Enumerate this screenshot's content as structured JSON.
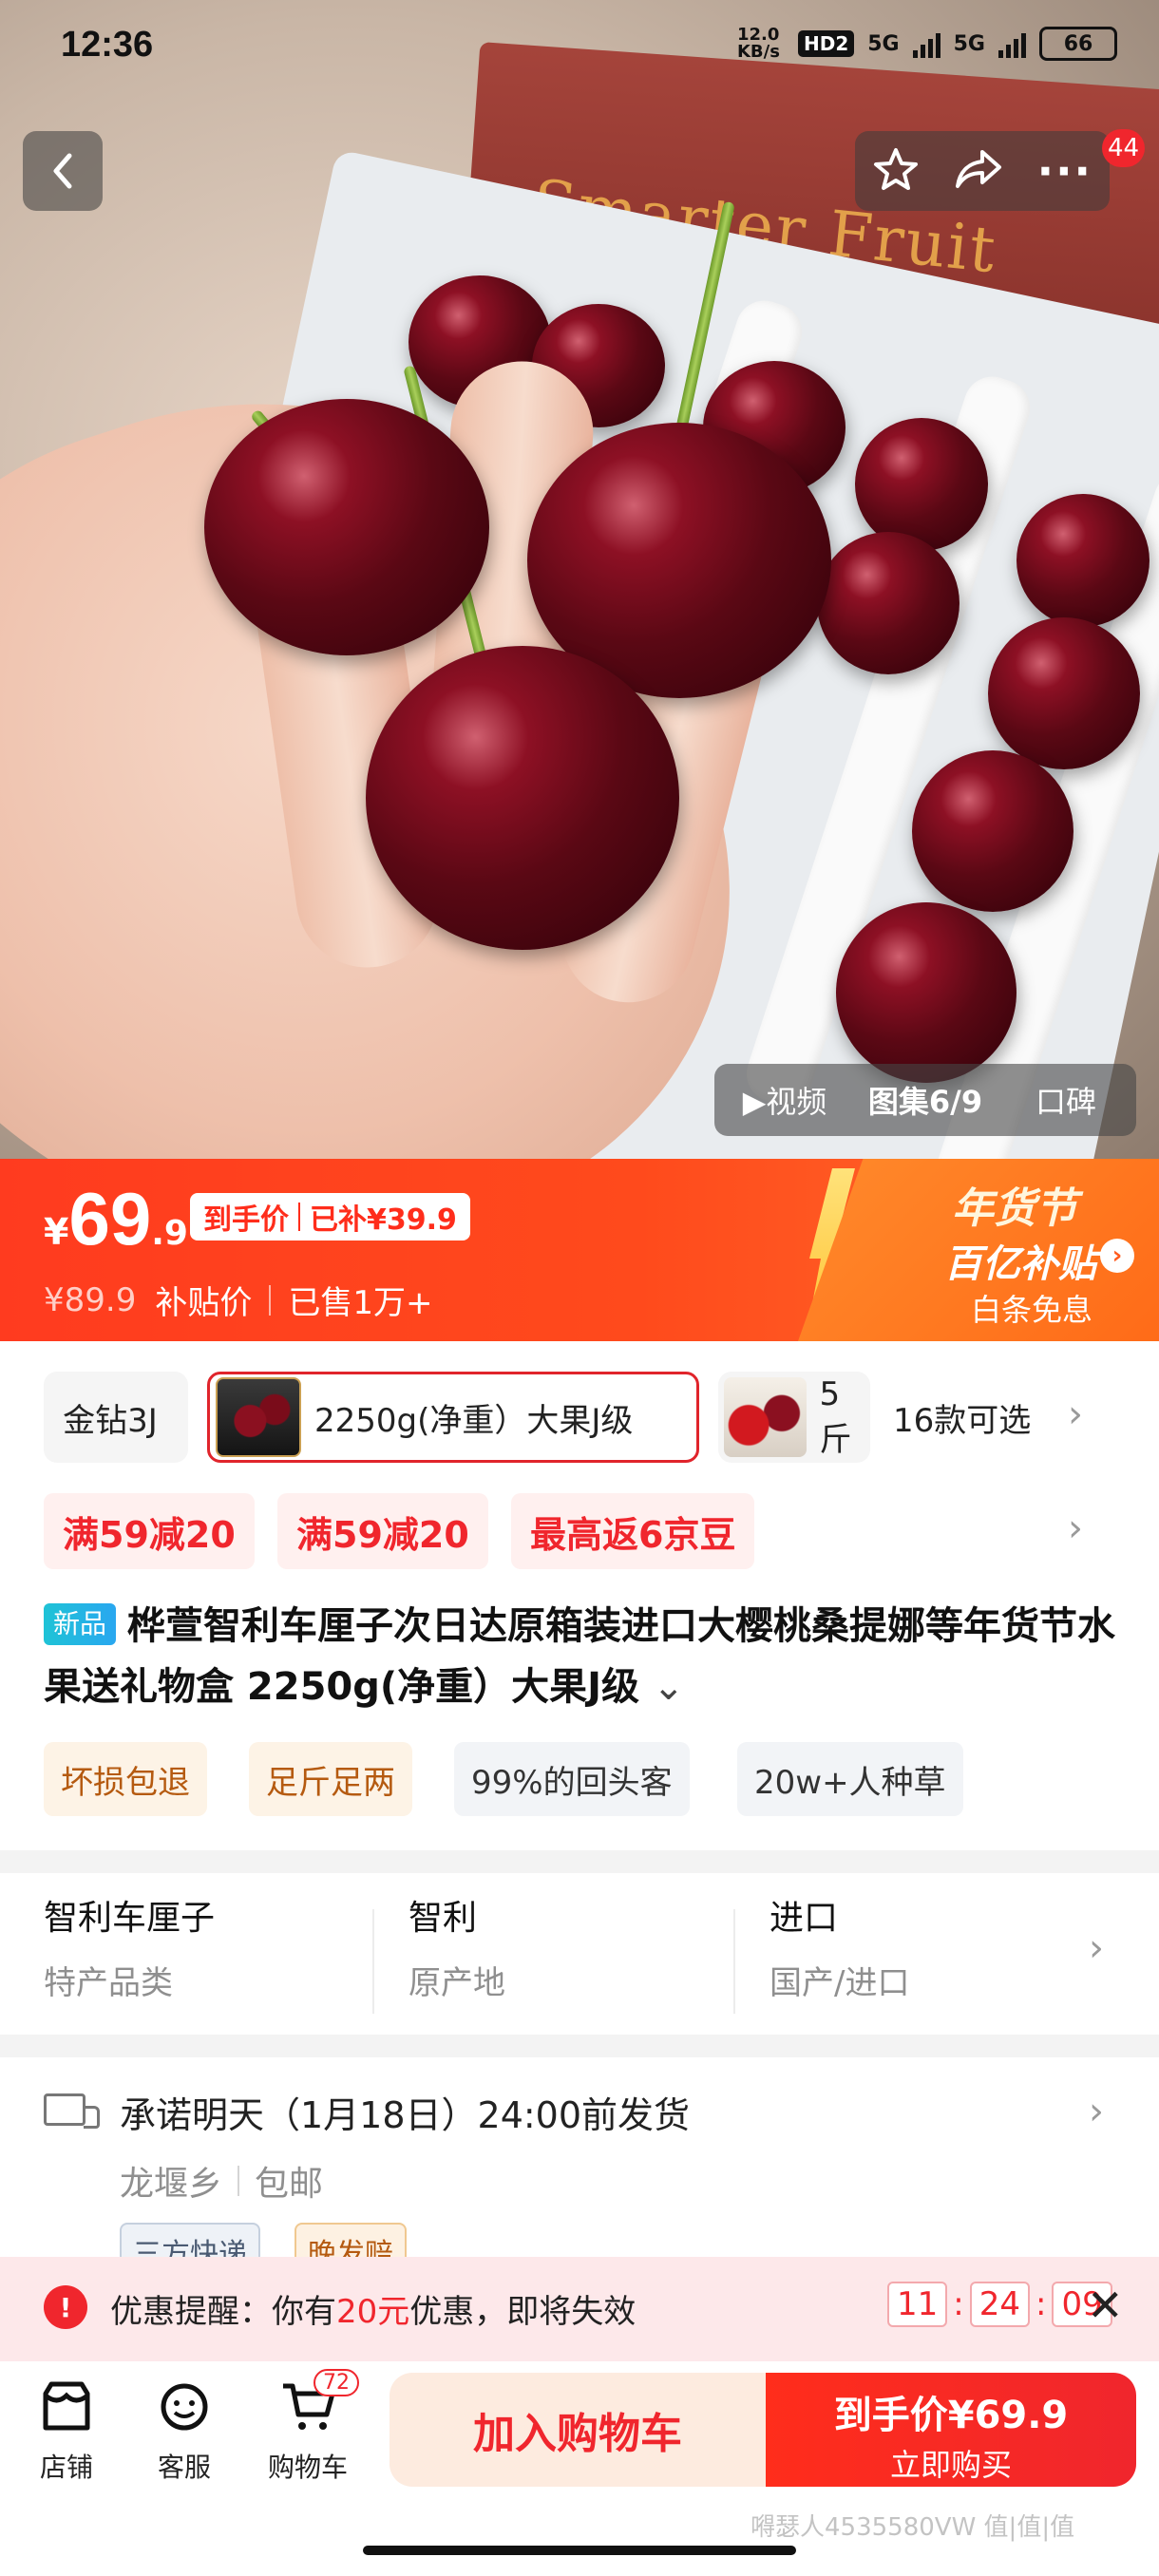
{
  "status_bar": {
    "time": "12:36",
    "net_speed": "12.0 KB/s",
    "hd": "HD2",
    "net1": "5G",
    "net2": "5G",
    "battery": "66"
  },
  "hero": {
    "box_print": "Smarter Fruit",
    "notification_badge": "44",
    "media_tabs": {
      "video": "视频",
      "gallery": "图集6/9",
      "reviews": "口碑"
    }
  },
  "price": {
    "currency": "¥",
    "integer": "69",
    "decimal": ".9",
    "tag_label": "到手价",
    "tag_subsidy": "已补¥39.9",
    "original": "¥89.9",
    "subsidy_label": "补贴价",
    "sold": "已售1万+",
    "festival_title": "年货节",
    "festival_sub": "百亿补贴",
    "installment": "白条免息"
  },
  "sku": {
    "options": [
      {
        "label": "金钻3J"
      },
      {
        "label": "2250g(净重）大果J级",
        "selected": true
      },
      {
        "label": "5斤"
      }
    ],
    "count": "16款可选"
  },
  "coupons": [
    "满59减20",
    "满59减20",
    "最高返6京豆"
  ],
  "title": {
    "new_tag": "新品",
    "text": "桦萱智利车厘子次日达原箱装进口大樱桃桑提娜等年货节水果送礼物盒 2250g(净重）大果J级",
    "expand": "⌄"
  },
  "features": [
    "坏损包退",
    "足斤足两",
    "99%的回头客",
    "20w+人种草"
  ],
  "attributes": [
    {
      "value": "智利车厘子",
      "key": "特产品类"
    },
    {
      "value": "智利",
      "key": "原产地"
    },
    {
      "value": "进口",
      "key": "国产/进口"
    }
  ],
  "delivery": {
    "promise": "承诺明天（1月18日）24:00前发货",
    "from": "龙堰乡",
    "shipping": "包邮",
    "tags": [
      "三方快递",
      "晚发赔"
    ]
  },
  "reminder": {
    "prefix": "优惠提醒：你有",
    "amount": "20元",
    "suffix": "优惠，即将失效",
    "timer": {
      "h": "11",
      "m": "24",
      "s": "09"
    }
  },
  "bottom_bar": {
    "store": "店铺",
    "service": "客服",
    "cart": "购物车",
    "cart_count": "72",
    "add_to_cart": "加入购物车",
    "buy_price": "到手价¥69.9",
    "buy_now": "立即购买"
  },
  "watermark": "嘚瑟人4535580VW 值|值|值"
}
